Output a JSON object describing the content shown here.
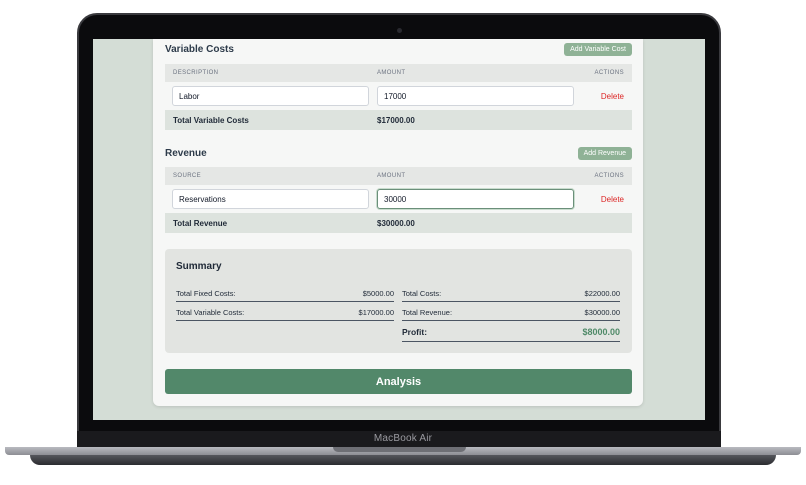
{
  "device": {
    "brand_label": "MacBook Air"
  },
  "variable_costs": {
    "title": "Variable Costs",
    "add_label": "Add Variable Cost",
    "columns": {
      "description": "DESCRIPTION",
      "amount": "AMOUNT",
      "actions": "ACTIONS"
    },
    "rows": [
      {
        "description": "Labor",
        "amount": "17000",
        "action": "Delete"
      }
    ],
    "total_label": "Total Variable Costs",
    "total_value": "$17000.00"
  },
  "revenue": {
    "title": "Revenue",
    "add_label": "Add Revenue",
    "columns": {
      "source": "SOURCE",
      "amount": "AMOUNT",
      "actions": "ACTIONS"
    },
    "rows": [
      {
        "source": "Reservations",
        "amount": "30000",
        "action": "Delete"
      }
    ],
    "total_label": "Total Revenue",
    "total_value": "$30000.00"
  },
  "summary": {
    "title": "Summary",
    "total_fixed_costs_label": "Total Fixed Costs:",
    "total_fixed_costs_value": "$5000.00",
    "total_variable_costs_label": "Total Variable Costs:",
    "total_variable_costs_value": "$17000.00",
    "total_costs_label": "Total Costs:",
    "total_costs_value": "$22000.00",
    "total_revenue_label": "Total Revenue:",
    "total_revenue_value": "$30000.00",
    "profit_label": "Profit:",
    "profit_value": "$8000.00"
  },
  "analysis_label": "Analysis",
  "colors": {
    "accent_green": "#52886a",
    "light_green_button": "#8fb296",
    "delete_red": "#dc2626",
    "profit_green": "#4f8a68",
    "screen_background": "#d4ddd6"
  }
}
